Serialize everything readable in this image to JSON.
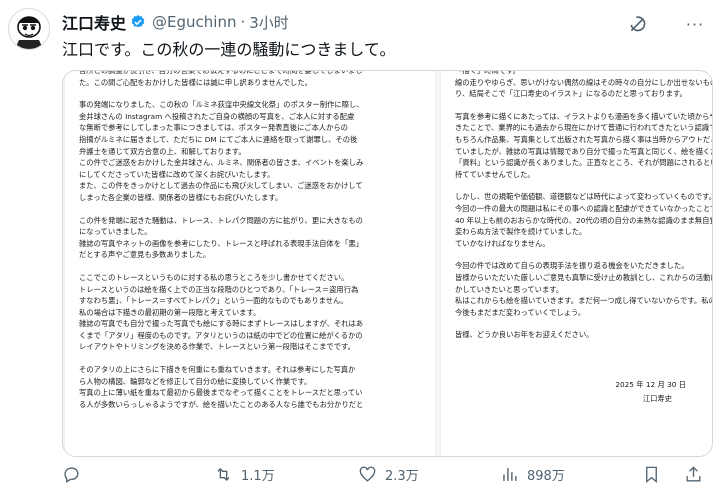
{
  "author": {
    "name": "江口寿史",
    "handle": "@Eguchinn",
    "separator": "·",
    "time": "3小时"
  },
  "tweet": {
    "text": "江口です。この秋の一連の騒動につきまして。"
  },
  "statement": {
    "left_lines": [
      "各所との調整が長引き、自分の言葉でお伝えするのにここまで時間を要してしまいまし",
      "た。この間ご心配をおかけした皆様には誠に申し訳ありませんでした。",
      "",
      "事の発端になりました、この秋の「ルミネ荻窪中央線文化祭」のポスター制作に際し、",
      "金井球さんの Instagram へ投稿されたご自身の横顔の写真を、ご本人に対する配慮",
      "な無断で参考にしてしまった事につきましては、ポスター発表直後にご本人からの",
      "指摘がルミネに届きまして、ただちに DM にてご本人に連絡を取って謝罪し、その後",
      "弁護士を通じて双方合意の上、和解しております。",
      "この件でご迷惑をおかけした金井球さん、ルミネ、関係者の皆さま、イベントを楽しみ",
      "にしてくださっていた皆様に改めて深くお詫びいたします。",
      "また、この件をきっかけとして過去の作品にも飛び火してしまい、ご迷惑をおかけして",
      "しまった各企業の皆様、関係者の皆様にもお詫びいたします。",
      "",
      "この件を発端に起きた騒動は、トレース、トレパク問題の方に拡がり、更に大きなもの",
      "になっていきました。",
      "雑誌の写真やネットの画像を参考にしたり、トレースと呼ばれる表現手法自体を「悪」",
      "だとする声やご意見も多数ありました。",
      "",
      "ここでこのトレースというものに対する私の思うところを少し書かせてください。",
      "トレースというのは絵を描く上での正当な段階のひとつであり、「トレース＝盗用行為",
      "すなわち悪」、「トレース＝すべてトレパク」という一面的なものでもありません。",
      "私の場合は下描きの最初期の第一段階と考えています。",
      "雑誌の写真でも自分で撮った写真でも絵にする時にまずトレースはしますが、それはあ",
      "くまで「アタリ」程度のものです。アタリというのは紙の中でどの位置に絵がくるかの",
      "レイアウトやトリミングを決める作業で、トレースという第一段階はそこまでです。",
      "",
      "そのアタリの上にさらに下描きを何重にも重ねていきます。それは参考にした写真か",
      "ら人物の構図、輪郭などを修正して自分の絵に変換していく作業です。",
      "写真の上に薄い紙を重ねて最初から最後までなぞって描くことをトレースだと思ってい",
      "る人が多数いらっしゃるようですが、絵を描いたことのある人なら誰でもお分かりだと"
    ],
    "right_lines": [
      "「描く」時間です。",
      "線の走りやゆらぎ、思いがけない偶然の線はその時々の自分にしか出せないものであ",
      "り、結局そこで「江口寿史のイラスト」になるのだと思っております。",
      "",
      "写真を参考に描くにあたっては、イラストよりも漫画を多く描いていた頃からやって",
      "きたことで、業界的にも過去から現在にかけて普通に行われてきたという認識です。",
      "もちろん作品集、写真集として出版された写真から描く事は当時からアウトだと考え",
      "ていましたが、雑誌の写真は情報であり自分で撮った写真と同じく、絵を描くための",
      "「資料」という認識が長くありました。正直なところ、それが問題にされるという認識は",
      "持てていませんでした。",
      "",
      "しかし、世の規範や価値観、道徳観などは時代によって変わっていくものです。",
      "今回の一件の最大の問題は私にその事への認識と配慮ができていなかったことです。",
      "40 年以上も前のおおらかな時代の、20代の頃の自分の未熟な認識のまま無自覚に",
      "変わらぬ方法で製作を続けていました。",
      "ていかなければなりません。",
      "",
      "今回の件では改めて自らの表現手法を振り返る機会をいただきました。",
      "皆様からいただいた厳しいご意見も真摯に受け止め教訓とし、これからの活動に生",
      "かしていきたいと思っています。",
      "私はこれからも絵を描いていきます。まだ何一つ成し得ていないからです。私の絵は",
      "今後もまだまだ変わっていくでしょう。",
      "",
      "皆様、どうか良いお年をお迎えください。"
    ],
    "date": "2025 年 12 月 30 日",
    "signature": "江口寿史"
  },
  "metrics": {
    "replies": "",
    "retweets": "1.1万",
    "likes": "2.3万",
    "views": "898万"
  },
  "colors": {
    "verified": "#1d9bf0",
    "muted": "#536471"
  },
  "icons": [
    "verified-badge-icon",
    "grok-icon",
    "more-icon",
    "reply-icon",
    "retweet-icon",
    "like-icon",
    "views-icon",
    "bookmark-icon",
    "share-icon"
  ]
}
